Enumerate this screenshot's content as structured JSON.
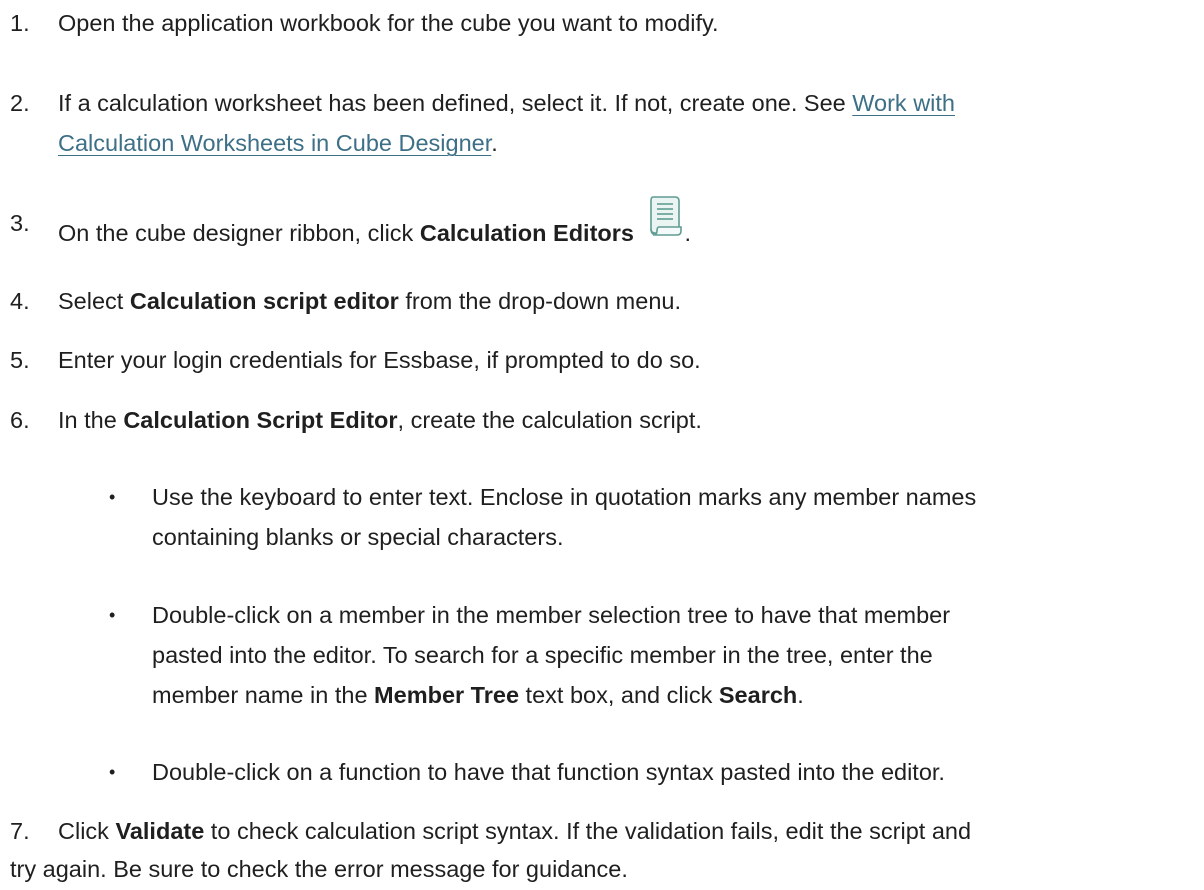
{
  "steps": [
    {
      "number": "1.",
      "text": "Open the application workbook for the cube you want to modify."
    },
    {
      "number": "2.",
      "text_before": "If a calculation worksheet has been defined, select it. If not, create one. See ",
      "link_line1": "Work with",
      "link_line2": "Calculation Worksheets in Cube Designer",
      "text_after": "."
    },
    {
      "number": "3.",
      "text_before": "On the cube designer ribbon, click ",
      "bold": "Calculation Editors",
      "icon": "calculation-editors-icon",
      "text_after": "."
    },
    {
      "number": "4.",
      "text_before": "Select ",
      "bold": "Calculation script editor",
      "text_after": " from the drop-down menu."
    },
    {
      "number": "5.",
      "text": "Enter your login credentials for Essbase, if prompted to do so."
    },
    {
      "number": "6.",
      "text_before": "In the ",
      "bold": "Calculation Script Editor",
      "text_after": ", create the calculation script."
    },
    {
      "number": "7.",
      "text_before": "Click ",
      "bold": "Validate",
      "line1_after": " to check calculation script syntax. If the validation fails, edit the script and",
      "line2": "try again. Be sure to check the error message for guidance."
    }
  ],
  "bullets": [
    {
      "line1": "Use the keyboard to enter text. Enclose in quotation marks any member names",
      "line2": "containing blanks or special characters."
    },
    {
      "line1": "Double-click on a member in the member selection tree to have that member",
      "line2": "pasted into the editor. To search for a specific member in the tree, enter the",
      "line3_before": "member name in the ",
      "line3_bold1": "Member Tree",
      "line3_middle": " text box, and click ",
      "line3_bold2": "Search",
      "line3_after": "."
    },
    {
      "line1": "Double-click on a function to have that function syntax pasted into the editor."
    }
  ],
  "bullet_glyph": "•",
  "colors": {
    "text": "#1f1f1f",
    "link": "#3d6f86"
  }
}
